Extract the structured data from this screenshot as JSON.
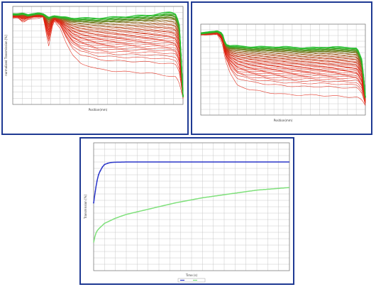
{
  "colors": {
    "frame": "#1f3a93",
    "grid": "#c8c8c8",
    "curve_high": "#22c22e",
    "curve_low": "#e02010",
    "blue_series": "#2a36c9",
    "green_series": "#7ee07a"
  },
  "chart_data": [
    {
      "type": "line",
      "title": "",
      "xlabel": "Position(mm)",
      "ylabel": "normalized Transmission [%]",
      "x": [
        0,
        0.03,
        0.06,
        0.09,
        0.12,
        0.15,
        0.18,
        0.21,
        0.24,
        0.28,
        0.31,
        0.35,
        0.4,
        0.5,
        0.6,
        0.7,
        0.8,
        0.88,
        0.93,
        0.96,
        0.98,
        1.0
      ],
      "envelope_top": [
        92,
        92,
        93,
        91,
        92,
        93,
        92,
        89,
        90,
        89,
        89,
        88,
        88,
        88,
        89,
        90,
        91,
        93,
        94,
        92,
        80,
        8
      ],
      "envelope_bottom": [
        88,
        88,
        83,
        87,
        88,
        88,
        89,
        58,
        86,
        78,
        64,
        50,
        42,
        36,
        34,
        33,
        32,
        30,
        29,
        28,
        20,
        6
      ],
      "curve_count": 40,
      "ylim": [
        0,
        100
      ],
      "grid": true
    },
    {
      "type": "line",
      "title": "",
      "xlabel": "Position(mm)",
      "ylabel": "",
      "x": [
        0,
        0.05,
        0.1,
        0.13,
        0.15,
        0.18,
        0.22,
        0.3,
        0.4,
        0.5,
        0.6,
        0.7,
        0.8,
        0.9,
        0.95,
        0.98,
        1.0
      ],
      "envelope_top": [
        90,
        91,
        92,
        90,
        78,
        76,
        76,
        75,
        75,
        75,
        74,
        74,
        75,
        74,
        74,
        60,
        20
      ],
      "envelope_bottom": [
        88,
        88,
        89,
        80,
        60,
        45,
        33,
        28,
        25,
        23,
        22,
        22,
        21,
        20,
        20,
        16,
        10
      ],
      "curve_count": 45,
      "ylim": [
        0,
        100
      ],
      "grid": true
    },
    {
      "type": "line",
      "title": "",
      "xlabel": "Time (s)",
      "ylabel": "Transmission [%]",
      "xlim": [
        0,
        3600
      ],
      "ylim": [
        0,
        100
      ],
      "grid": true,
      "legend_position": "bottom",
      "series": [
        {
          "x": [
            0,
            30,
            60,
            90,
            120,
            160,
            200,
            260,
            320,
            400,
            600,
            1000,
            1500,
            2000,
            2500,
            3000,
            3600
          ],
          "values": [
            53,
            62,
            70,
            75,
            78,
            81,
            83,
            84,
            84.6,
            84.8,
            85,
            85,
            85,
            85,
            85,
            85,
            85
          ]
        },
        {
          "x": [
            0,
            30,
            60,
            100,
            150,
            200,
            300,
            400,
            600,
            800,
            1000,
            1500,
            2000,
            2500,
            3000,
            3600
          ],
          "values": [
            22,
            28,
            31,
            33,
            35,
            37,
            39,
            41,
            44,
            46,
            48,
            53,
            57,
            60,
            63,
            65
          ]
        }
      ]
    }
  ]
}
